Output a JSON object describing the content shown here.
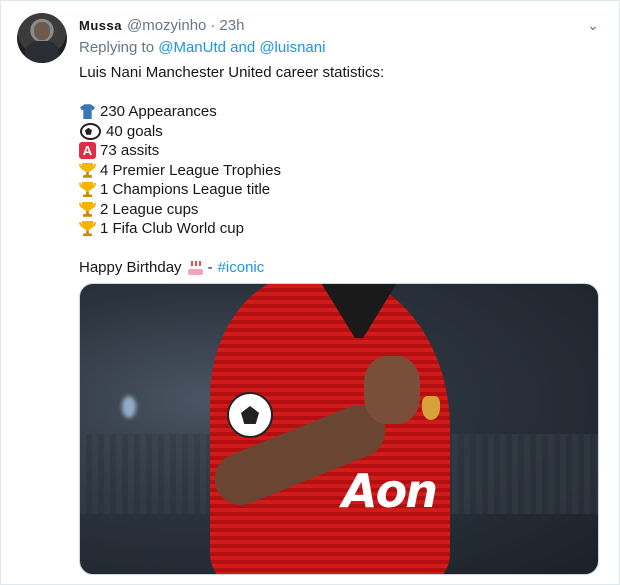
{
  "tweet": {
    "name": "Mussa",
    "handle": "@mozyinho",
    "separator": "·",
    "time": "23h",
    "reply_prefix": "Replying to",
    "reply_mentions": "@ManUtd and @luisnani",
    "intro": "Luis Nani Manchester United career statistics:",
    "stats": [
      {
        "icon": "shirt-icon",
        "text": "230 Appearances"
      },
      {
        "icon": "soccer-ball-icon",
        "text": "40 goals"
      },
      {
        "icon": "letter-a-icon",
        "text": "73 assits"
      },
      {
        "icon": "trophy-icon",
        "text": "4 Premier League Trophies"
      },
      {
        "icon": "trophy-icon",
        "text": "1 Champions League title"
      },
      {
        "icon": "trophy-icon",
        "text": "2 League cups"
      },
      {
        "icon": "trophy-icon",
        "text": "1 Fifa Club World cup"
      }
    ],
    "closing_text": "Happy Birthday",
    "closing_icon": "birthday-cake-icon",
    "closing_sep": "-",
    "hashtag": "#iconic",
    "letter_a": "A",
    "media_sponsor_text": "Aon",
    "colors": {
      "link": "#1b95e0",
      "muted": "#657786",
      "text": "#14171a"
    }
  }
}
